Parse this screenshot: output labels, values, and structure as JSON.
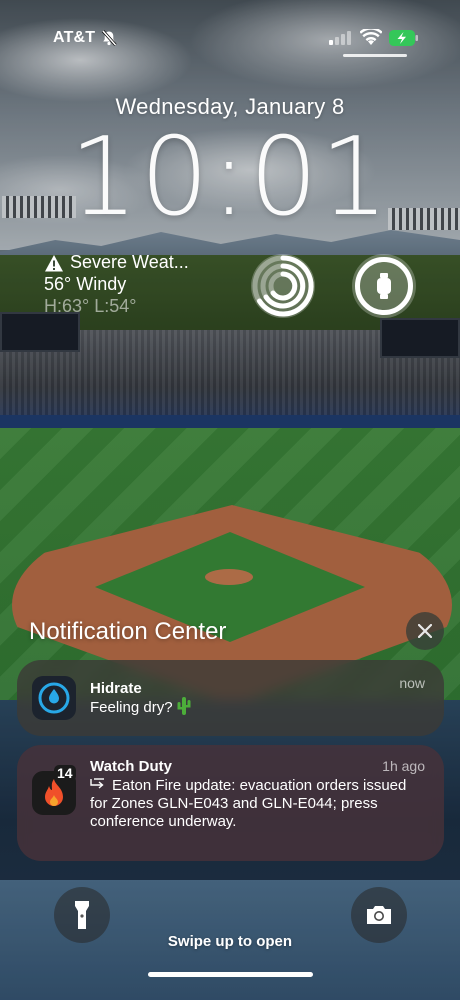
{
  "status_bar": {
    "carrier": "AT&T",
    "mute_icon": "bell-slash-icon",
    "signal_icon": "cellular-signal-icon",
    "wifi_icon": "wifi-icon",
    "battery_icon": "battery-charging-icon",
    "battery_color": "#34c759"
  },
  "lock_screen": {
    "date": "Wednesday, January 8",
    "time": "10:01"
  },
  "widgets": {
    "weather": {
      "alert": "Severe Weat...",
      "alert_icon": "warning-triangle-icon",
      "current": "56° Windy",
      "hi_lo": "H:63° L:54°"
    },
    "activity": {
      "icon": "activity-rings-icon"
    },
    "watch": {
      "icon": "apple-watch-icon"
    }
  },
  "notification_center": {
    "title": "Notification Center",
    "close_icon": "close-icon",
    "notifications": [
      {
        "app": "Hidrate",
        "time": "now",
        "message": "Feeling dry?",
        "icon": "water-drop-icon",
        "emoji_icon": "cactus-icon"
      },
      {
        "app": "Watch Duty",
        "time": "1h ago",
        "badge": "14",
        "message": "Eaton Fire update: evacuation orders issued for Zones GLN-E043 and GLN-E044; press conference underway.",
        "icon": "fire-icon",
        "thread_icon": "thread-arrow-icon"
      }
    ]
  },
  "bottom": {
    "flashlight_icon": "flashlight-icon",
    "camera_icon": "camera-icon",
    "swipe_text": "Swipe up to open"
  }
}
